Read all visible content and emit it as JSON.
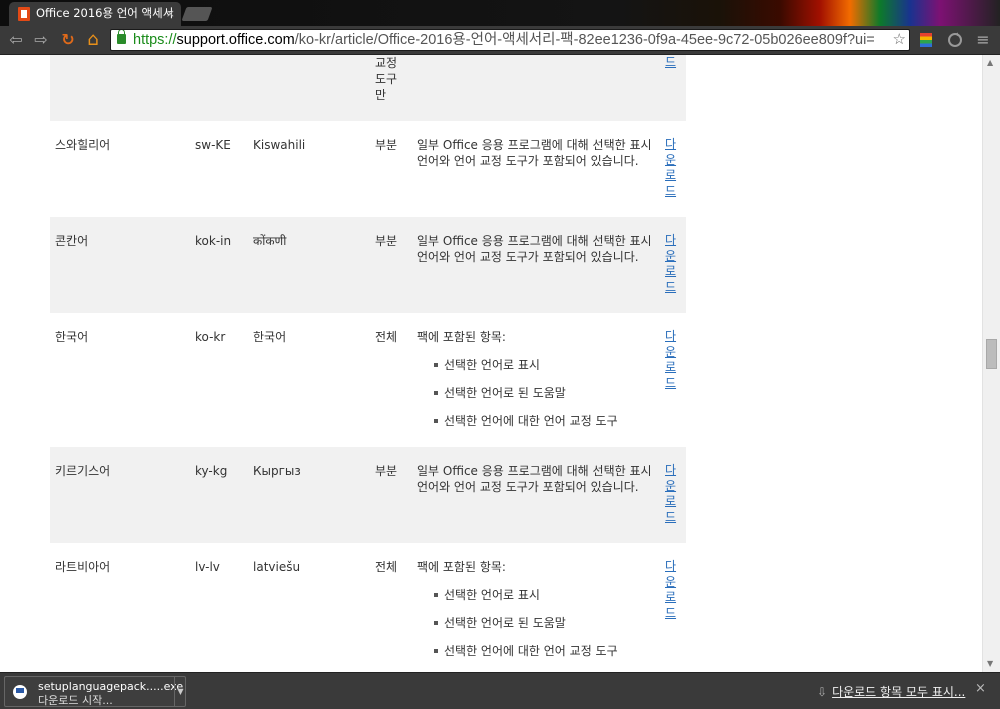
{
  "browser": {
    "tab_title": "Office 2016용 언어 액세서",
    "tab_close": "×",
    "url_scheme": "https://",
    "url_host": "support.office.com",
    "url_path": "/ko-kr/article/Office-2016용-언어-액세서리-팩-82ee1236-0f9a-45ee-9c72-05b026ee809f?ui=",
    "star": "☆",
    "back": "⇦",
    "forward": "⇨",
    "reload": "↻",
    "home": "⌂",
    "menu": "≡"
  },
  "table": {
    "top_row": {
      "scope_lines": [
        "교정",
        "도구",
        "만"
      ],
      "download": "드"
    },
    "rows": [
      {
        "language": "스와힐리어",
        "code": "sw-KE",
        "native": "Kiswahili",
        "scope": "부분",
        "description": "일부 Office 응용 프로그램에 대해 선택한 표시 언어와 언어 교정 도구가 포함되어 있습니다.",
        "download": "다운로드"
      },
      {
        "language": "콘칸어",
        "code": "kok-in",
        "native": "कोंकणी",
        "scope": "부분",
        "description": "일부 Office 응용 프로그램에 대해 선택한 표시 언어와 언어 교정 도구가 포함되어 있습니다.",
        "download": "다운로드"
      },
      {
        "language": "한국어",
        "code": "ko-kr",
        "native": "한국어",
        "scope": "전체",
        "description": "팩에 포함된 항목:",
        "bullets": [
          "선택한 언어로 표시",
          "선택한 언어로 된 도움말",
          "선택한 언어에 대한 언어 교정 도구"
        ],
        "download": "다운로드"
      },
      {
        "language": "키르기스어",
        "code": "ky-kg",
        "native": "Кыргыз",
        "scope": "부분",
        "description": "일부 Office 응용 프로그램에 대해 선택한 표시 언어와 언어 교정 도구가 포함되어 있습니다.",
        "download": "다운로드"
      },
      {
        "language": "라트비아어",
        "code": "lv-lv",
        "native": "latviešu",
        "scope": "전체",
        "description": "팩에 포함된 항목:",
        "bullets": [
          "선택한 언어로 표시",
          "선택한 언어로 된 도움말",
          "선택한 언어에 대한 언어 교정 도구"
        ],
        "download": "다운로드"
      }
    ]
  },
  "downloads": {
    "filename": "setuplanguagepack.....exe",
    "status": "다운로드 시작...",
    "show_all": "다운로드 항목 모두 표시...",
    "close": "×"
  }
}
